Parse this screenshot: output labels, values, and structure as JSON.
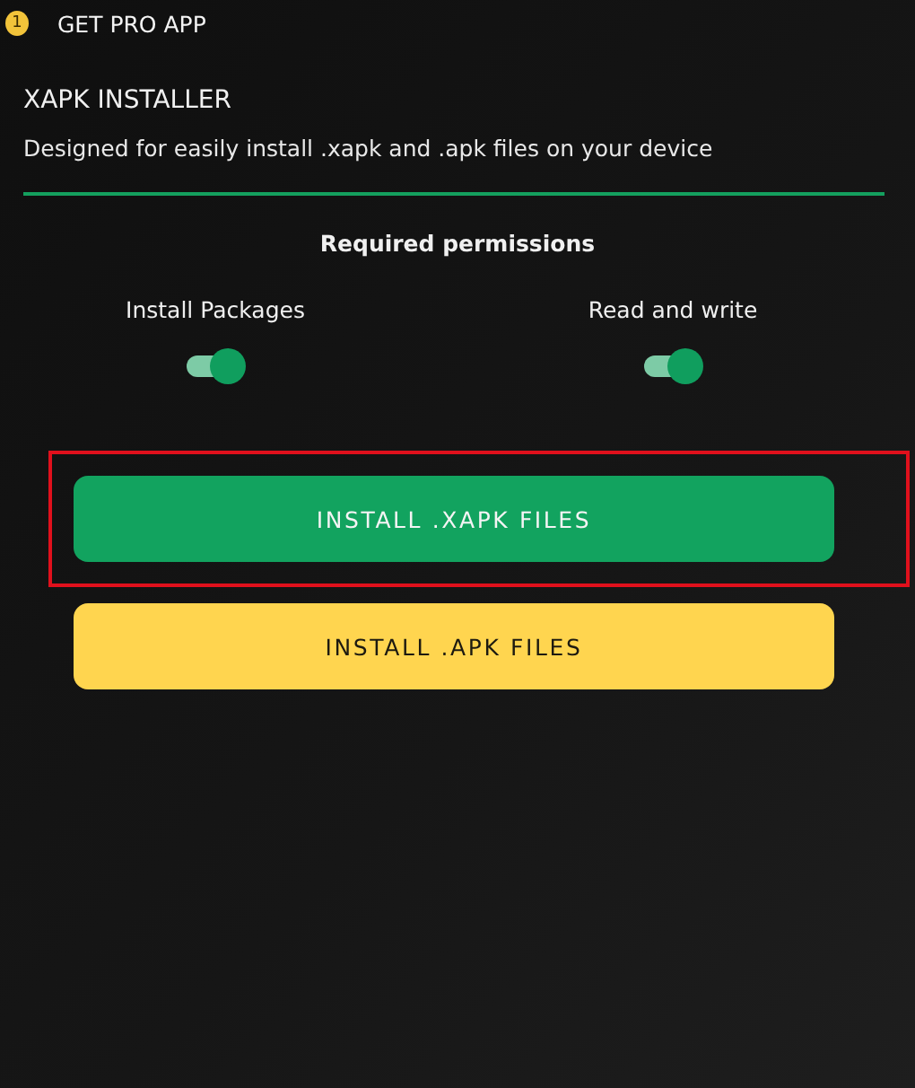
{
  "top_bar": {
    "label": "GET PRO APP",
    "badge": "1"
  },
  "header": {
    "title": "XAPK INSTALLER",
    "description": "Designed for easily install .xapk and .apk files on your device"
  },
  "permissions": {
    "heading": "Required permissions",
    "items": [
      {
        "label": "Install Packages",
        "on": true
      },
      {
        "label": "Read and write",
        "on": true
      }
    ]
  },
  "buttons": [
    {
      "label": "INSTALL .XAPK FILES",
      "kind": "primary",
      "highlighted": true
    },
    {
      "label": "INSTALL .APK FILES",
      "kind": "secondary",
      "highlighted": false
    }
  ]
}
